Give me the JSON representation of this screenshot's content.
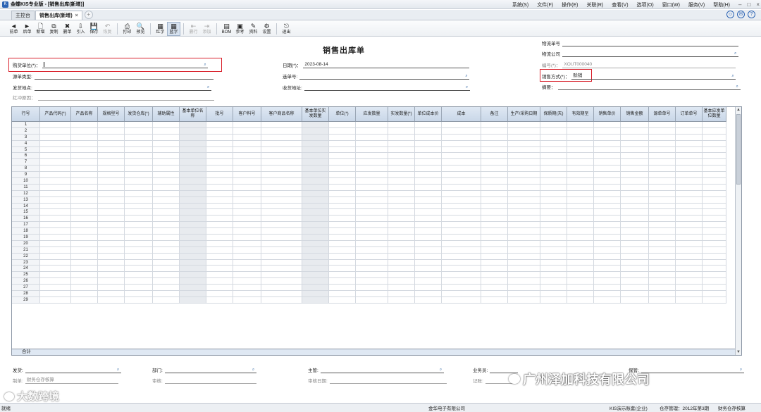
{
  "app": {
    "title": "金蝶KIS专业版 - [销售出库(新增)]",
    "menus": [
      "系统(S)",
      "文件(F)",
      "操作(E)",
      "关联(R)",
      "查看(V)",
      "选项(O)",
      "窗口(W)",
      "服务(V)",
      "帮助(H)"
    ]
  },
  "tabs": [
    {
      "label": "主控台",
      "active": false
    },
    {
      "label": "销售出库(新增)",
      "active": true
    }
  ],
  "toolbar": [
    {
      "label": "前单",
      "icon": "◄",
      "name": "prev-doc",
      "disabled": false
    },
    {
      "label": "后单",
      "icon": "►",
      "name": "next-doc",
      "disabled": false
    },
    {
      "label": "新增",
      "icon": "🗋",
      "name": "new",
      "disabled": false
    },
    {
      "label": "复制",
      "icon": "⧉",
      "name": "copy",
      "disabled": false
    },
    {
      "label": "删单",
      "icon": "✖",
      "name": "delete",
      "disabled": false
    },
    {
      "label": "引入",
      "icon": "⇩",
      "name": "import",
      "disabled": false
    },
    {
      "label": "保存",
      "icon": "💾",
      "name": "save",
      "disabled": false
    },
    {
      "label": "恢复",
      "icon": "↶",
      "name": "restore",
      "disabled": true
    },
    {
      "label": "打印",
      "icon": "⎙",
      "name": "print",
      "disabled": false
    },
    {
      "label": "预览",
      "icon": "🔍",
      "name": "preview",
      "disabled": false
    },
    {
      "label": "红字",
      "icon": "▦",
      "name": "red-ink",
      "disabled": false
    },
    {
      "label": "蓝字",
      "icon": "▦",
      "name": "blue-ink",
      "disabled": false,
      "pressed": true
    },
    {
      "label": "删行",
      "icon": "⇤",
      "name": "delete-row",
      "disabled": true
    },
    {
      "label": "添加",
      "icon": "⇥",
      "name": "add-row",
      "disabled": true
    },
    {
      "label": "BOM",
      "icon": "▤",
      "name": "bom",
      "disabled": false
    },
    {
      "label": "参考",
      "icon": "▣",
      "name": "reference",
      "disabled": false
    },
    {
      "label": "资料",
      "icon": "✎",
      "name": "data",
      "disabled": false
    },
    {
      "label": "设置",
      "icon": "⚙",
      "name": "settings",
      "disabled": false
    },
    {
      "label": "退出",
      "icon": "⎋",
      "name": "exit",
      "disabled": false
    }
  ],
  "form": {
    "title": "销售出库单",
    "purchase_unit_label": "购货单位(*)：",
    "purchase_unit_value": "",
    "source_type_label": "源单类型:",
    "delivery_place_label": "发货地点:",
    "red_reason_label": "红冲原因：",
    "date_label": "日期(*)：",
    "date_value": "2023-08-14",
    "source_no_label": "选单号:",
    "receive_addr_label": "收货地址:",
    "logistics_no_label": "物流单号",
    "logistics_co_label": "物流公司",
    "doc_no_label": "编号(*)：",
    "doc_no_value": "XOUT000040",
    "sale_method_label": "销售方式(*)：",
    "sale_method_value": "赊销",
    "summary_label": "摘要："
  },
  "grid": {
    "columns": [
      "行号",
      "产品代码(*)",
      "产品名称",
      "规格型号",
      "发货仓库(*)",
      "辅助属性",
      "基本单位名称",
      "批号",
      "客户料号",
      "客户商品名称",
      "基本单位实发数量",
      "单位(*)",
      "应发数量",
      "实发数量(*)",
      "单位成本价",
      "成本",
      "备注",
      "生产/采购日期",
      "保质期(天)",
      "有效期至",
      "销售单价",
      "销售金额",
      "源单单号",
      "订单单号",
      "基本应发单位数量"
    ],
    "rows": [
      "1",
      "2",
      "3",
      "4",
      "5",
      "6",
      "7",
      "8",
      "9",
      "10",
      "11",
      "12",
      "13",
      "14",
      "15",
      "16",
      "17",
      "18",
      "19",
      "20",
      "21",
      "22",
      "23",
      "24",
      "25",
      "26",
      "27",
      "28",
      "29"
    ],
    "total_label": "合计"
  },
  "footer": {
    "shipper_label": "发货:",
    "dept_label": "部门:",
    "manager_label": "主管:",
    "salesman_label": "业务员:",
    "preparer_label": "制单:",
    "preparer_value": "财务仓存核算",
    "auditor_label": "审核:",
    "audit_date_label": "审核日期:",
    "bookkeeper_label": "记账:",
    "keeper_label": "保管:"
  },
  "status": {
    "ready": "就绪",
    "company": "金华电子有限公司",
    "account_set": "KIS演示账套(企业)",
    "period": "仓存管理：2012年第3期",
    "user": "财务仓存核算"
  },
  "watermarks": {
    "left": "大数跨境",
    "right": "广州泽加科技有限公司"
  }
}
